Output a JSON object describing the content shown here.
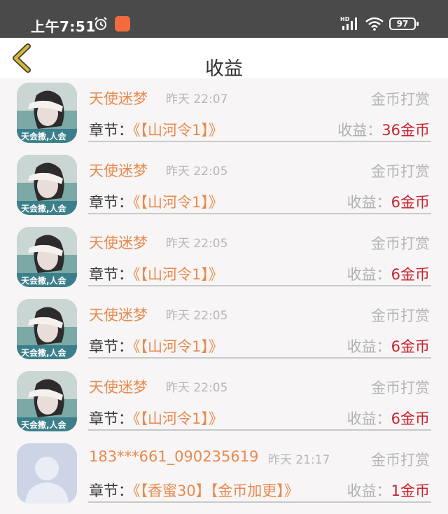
{
  "status_bar": {
    "time": "上午7:51",
    "battery": "97",
    "network_badge": "HD"
  },
  "header": {
    "title": "收益"
  },
  "items": [
    {
      "user": "天使迷梦",
      "time": "昨天 22:07",
      "type": "金币打赏",
      "chapter_prefix": "章节：",
      "chapter": "《【山河令1】》",
      "income_label": "收益：",
      "income": "36金币",
      "avatar": "photo"
    },
    {
      "user": "天使迷梦",
      "time": "昨天 22:05",
      "type": "金币打赏",
      "chapter_prefix": "章节：",
      "chapter": "《【山河令1】》",
      "income_label": "收益：",
      "income": "6金币",
      "avatar": "photo"
    },
    {
      "user": "天使迷梦",
      "time": "昨天 22:05",
      "type": "金币打赏",
      "chapter_prefix": "章节：",
      "chapter": "《【山河令1】》",
      "income_label": "收益：",
      "income": "6金币",
      "avatar": "photo"
    },
    {
      "user": "天使迷梦",
      "time": "昨天 22:05",
      "type": "金币打赏",
      "chapter_prefix": "章节：",
      "chapter": "《【山河令1】》",
      "income_label": "收益：",
      "income": "6金币",
      "avatar": "photo"
    },
    {
      "user": "天使迷梦",
      "time": "昨天 22:05",
      "type": "金币打赏",
      "chapter_prefix": "章节：",
      "chapter": "《【山河令1】》",
      "income_label": "收益：",
      "income": "6金币",
      "avatar": "photo"
    },
    {
      "user": "183***661_090235619",
      "time": "昨天 21:17",
      "type": "金币打赏",
      "chapter_prefix": "章节：",
      "chapter": "《【香蜜30】【金币加更】》",
      "income_label": "收益：",
      "income": "1金币",
      "avatar": "default"
    }
  ],
  "colors": {
    "accent_orange": "#e88a4e",
    "income_red": "#c8242f",
    "back_arrow": "#d6b632"
  }
}
